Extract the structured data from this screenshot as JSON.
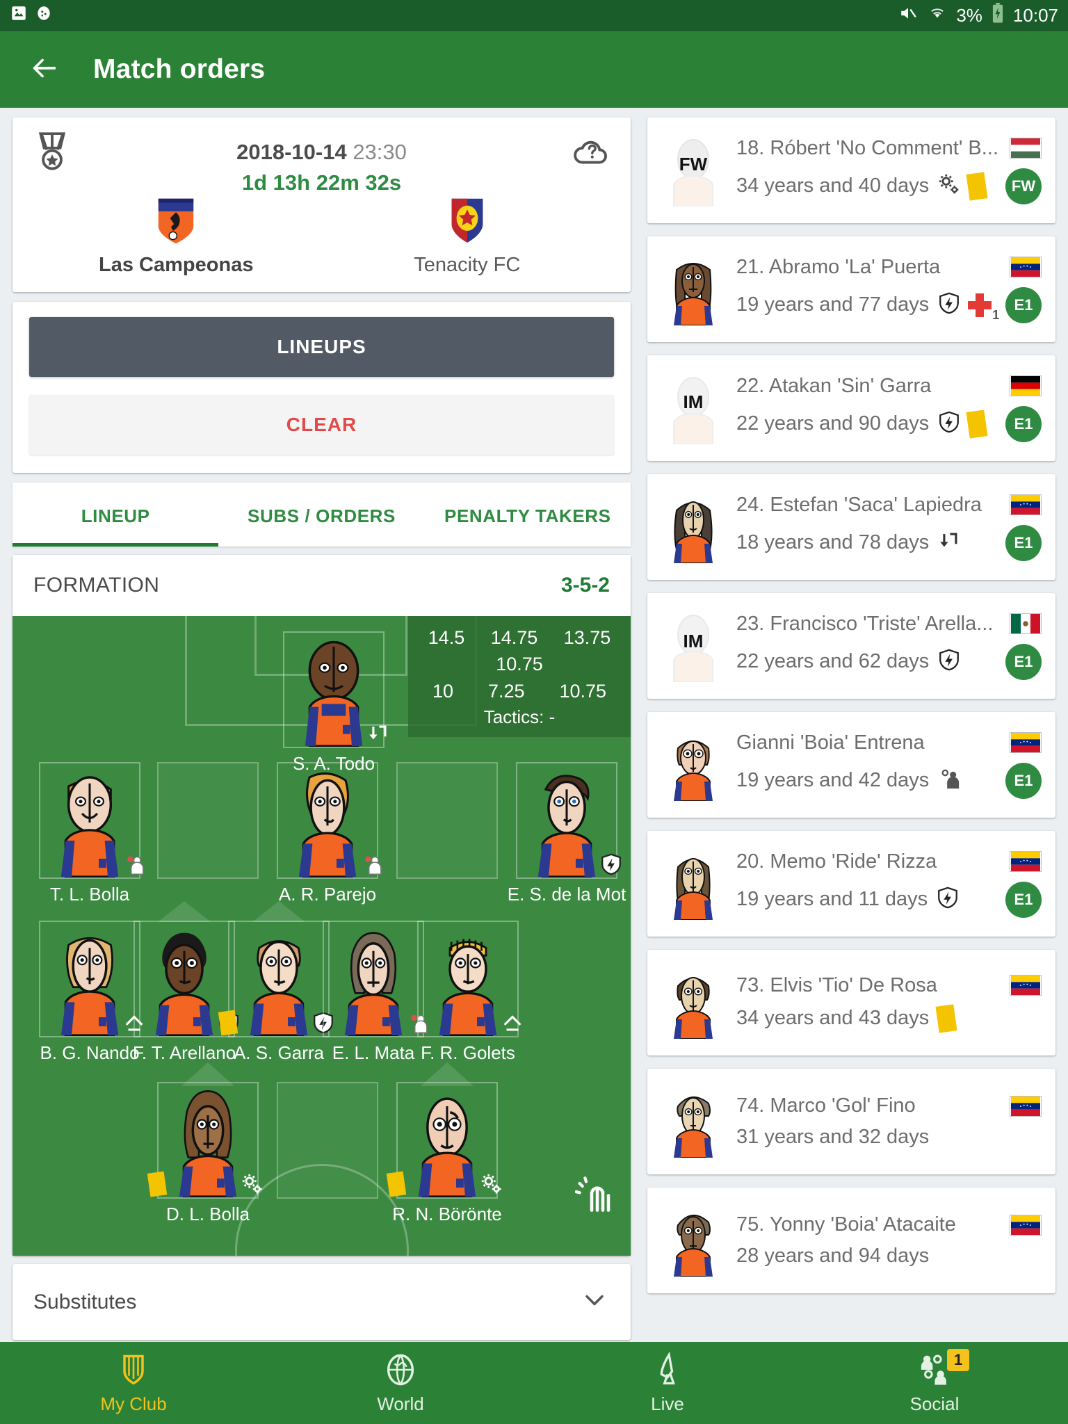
{
  "status_bar": {
    "icons": [
      "image-icon",
      "game-controller-icon"
    ],
    "right_icons": [
      "mute-icon",
      "wifi-icon",
      "battery-charging-icon"
    ],
    "battery": "3%",
    "time": "10:07"
  },
  "app_bar": {
    "back_icon": "back-arrow-icon",
    "title": "Match orders"
  },
  "match": {
    "medal_icon": "medal-icon",
    "weather_icon": "weather-unknown-icon",
    "date": "2018-10-14",
    "time": "23:30",
    "countdown": "1d 13h 22m 32s",
    "home_team": "Las Campeonas",
    "away_team": "Tenacity FC"
  },
  "actions": {
    "lineups_label": "LINEUPS",
    "clear_label": "CLEAR"
  },
  "tabs": [
    {
      "label": "LINEUP",
      "active": true
    },
    {
      "label": "SUBS / ORDERS",
      "active": false
    },
    {
      "label": "PENALTY TAKERS",
      "active": false
    }
  ],
  "formation": {
    "label": "FORMATION",
    "value": "3-5-2"
  },
  "pitch_stats": {
    "top": [
      "14.5",
      "14.75",
      "13.75"
    ],
    "mid": [
      "10.75"
    ],
    "bottom": [
      "10",
      "7.25",
      "10.75"
    ],
    "tactics": "Tactics: -"
  },
  "lineup": {
    "goalkeeper": {
      "name": "S. A. Todo",
      "icons": [
        "order-arrow-icon"
      ]
    },
    "defenders": [
      {
        "name": "T. L. Bolla",
        "icons": [
          "man-marking-icon"
        ]
      },
      {
        "name": "A. R. Parejo",
        "icons": [
          "man-marking-icon"
        ]
      },
      {
        "name": "E. S. de la Mot",
        "icons": [
          "stamina-shield-icon"
        ]
      }
    ],
    "midfielders": [
      {
        "name": "B. G. Nando",
        "icons": [
          "form-arrow-icon"
        ]
      },
      {
        "name": "F. T. Arellano",
        "icons": [
          "stamina-shield-icon"
        ]
      },
      {
        "name": "A. S. Garra",
        "icons": [
          "yellow-card-icon",
          "stamina-shield-icon"
        ]
      },
      {
        "name": "E. L. Mata",
        "icons": [
          "man-marking-icon"
        ]
      },
      {
        "name": "F. R. Golets",
        "icons": [
          "form-arrow-icon"
        ]
      }
    ],
    "forwards": [
      {
        "name": "D. L. Bolla",
        "icons": [
          "yellow-card-icon",
          "gears-icon"
        ]
      },
      {
        "name": "R. N. Börönte",
        "icons": [
          "yellow-card-icon",
          "gears-icon"
        ]
      }
    ],
    "fingerprint_icon": "fingerprint-icon"
  },
  "substitutes": {
    "label": "Substitutes",
    "chevron_icon": "chevron-down-icon"
  },
  "player_list": [
    {
      "name": "18. Róbert 'No Comment' B...",
      "age": "34 years and 40 days",
      "flag": "hungary",
      "avatar_label": "FW",
      "avatar_faded": true,
      "icons": [
        "gears-icon",
        "yellow-card-icon"
      ],
      "role": "FW"
    },
    {
      "name": "21. Abramo 'La' Puerta",
      "age": "19 years and 77 days",
      "flag": "venezuela",
      "avatar_label": "",
      "avatar_faded": false,
      "icons": [
        "stamina-shield-icon",
        "injury-cross-icon"
      ],
      "injury_count": "1",
      "role": "E1"
    },
    {
      "name": "22. Atakan 'Sin' Garra",
      "age": "22 years and 90 days",
      "flag": "germany",
      "avatar_label": "IM",
      "avatar_faded": true,
      "icons": [
        "stamina-shield-icon",
        "yellow-card-icon"
      ],
      "role": "E1"
    },
    {
      "name": "24. Estefan 'Saca' Lapiedra",
      "age": "18 years and 78 days",
      "flag": "venezuela",
      "avatar_label": "",
      "avatar_faded": false,
      "icons": [
        "order-arrow-icon"
      ],
      "role": "E1"
    },
    {
      "name": "23. Francisco 'Triste' Arella...",
      "age": "22 years and 62 days",
      "flag": "mexico",
      "avatar_label": "IM",
      "avatar_faded": true,
      "icons": [
        "stamina-shield-icon"
      ],
      "role": "E1"
    },
    {
      "name": "Gianni 'Boia' Entrena",
      "age": "19 years and 42 days",
      "flag": "venezuela",
      "avatar_label": "",
      "avatar_faded": false,
      "icons": [
        "man-marking-icon"
      ],
      "role": "E1"
    },
    {
      "name": "20. Memo 'Ride' Rizza",
      "age": "19 years and 11 days",
      "flag": "venezuela",
      "avatar_label": "",
      "avatar_faded": false,
      "icons": [
        "stamina-shield-icon"
      ],
      "role": "E1"
    },
    {
      "name": "73. Elvis 'Tio' De Rosa",
      "age": "34 years and 43 days",
      "flag": "venezuela",
      "avatar_label": "",
      "avatar_faded": false,
      "icons": [
        "yellow-card-icon"
      ],
      "role": ""
    },
    {
      "name": "74. Marco 'Gol' Fino",
      "age": "31 years and 32 days",
      "flag": "venezuela",
      "avatar_label": "",
      "avatar_faded": false,
      "icons": [],
      "role": ""
    },
    {
      "name": "75. Yonny 'Boia' Atacaite",
      "age": "28 years and 94 days",
      "flag": "venezuela",
      "avatar_label": "",
      "avatar_faded": false,
      "icons": [],
      "role": ""
    }
  ],
  "bottom_nav": [
    {
      "label": "My Club",
      "icon": "shield-icon",
      "active": true,
      "badge": ""
    },
    {
      "label": "World",
      "icon": "globe-icon",
      "active": false,
      "badge": ""
    },
    {
      "label": "Live",
      "icon": "antenna-icon",
      "active": false,
      "badge": ""
    },
    {
      "label": "Social",
      "icon": "people-icon",
      "active": false,
      "badge": "1"
    }
  ],
  "colors": {
    "brand_green": "#2b8236",
    "status_green": "#1a5c2a",
    "accent_green": "#2e8b41",
    "clear_red": "#e04a4a",
    "lineups_gray": "#525a66",
    "pitch_green": "#3c8a42",
    "yellow": "#f3c21c"
  }
}
